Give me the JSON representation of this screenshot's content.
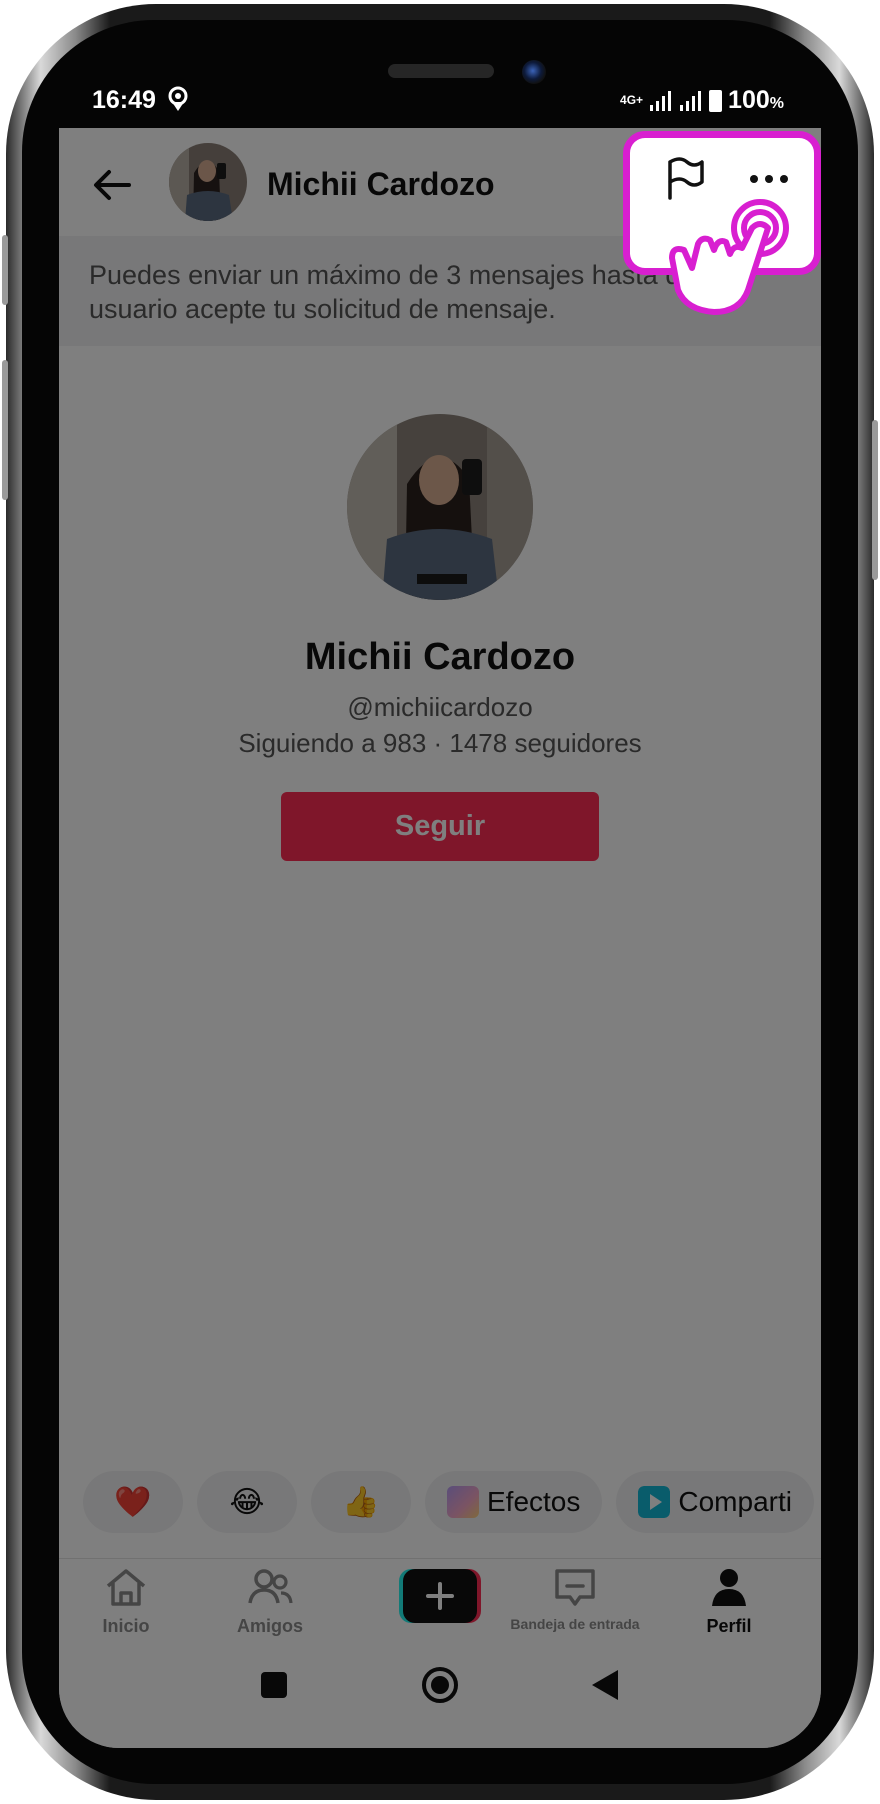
{
  "status_bar": {
    "time": "16:49",
    "network": "4G+",
    "battery": "100",
    "battery_unit": "%"
  },
  "header": {
    "back_icon": "arrow-left-icon",
    "name": "Michii Cardozo",
    "flag_icon": "flag-icon",
    "more_icon": "more-horizontal-icon"
  },
  "notice": "Puedes enviar un máximo de 3 mensajes hasta que el usuario acepte tu solicitud de mensaje.",
  "profile": {
    "name": "Michii Cardozo",
    "handle": "@michiicardozo",
    "stats": "Siguiendo a 983 · 1478 seguidores",
    "follow_label": "Seguir"
  },
  "quick_actions": {
    "emoji_heart": "❤️",
    "emoji_laugh": "😂",
    "emoji_thumbs": "👍",
    "effects": "Efectos",
    "share": "Comparti"
  },
  "bottom_nav": {
    "home": "Inicio",
    "friends": "Amigos",
    "inbox": "Bandeja de entrada",
    "profile": "Perfil"
  },
  "colors": {
    "accent": "#fe2c55",
    "highlight": "#d81fd0"
  }
}
